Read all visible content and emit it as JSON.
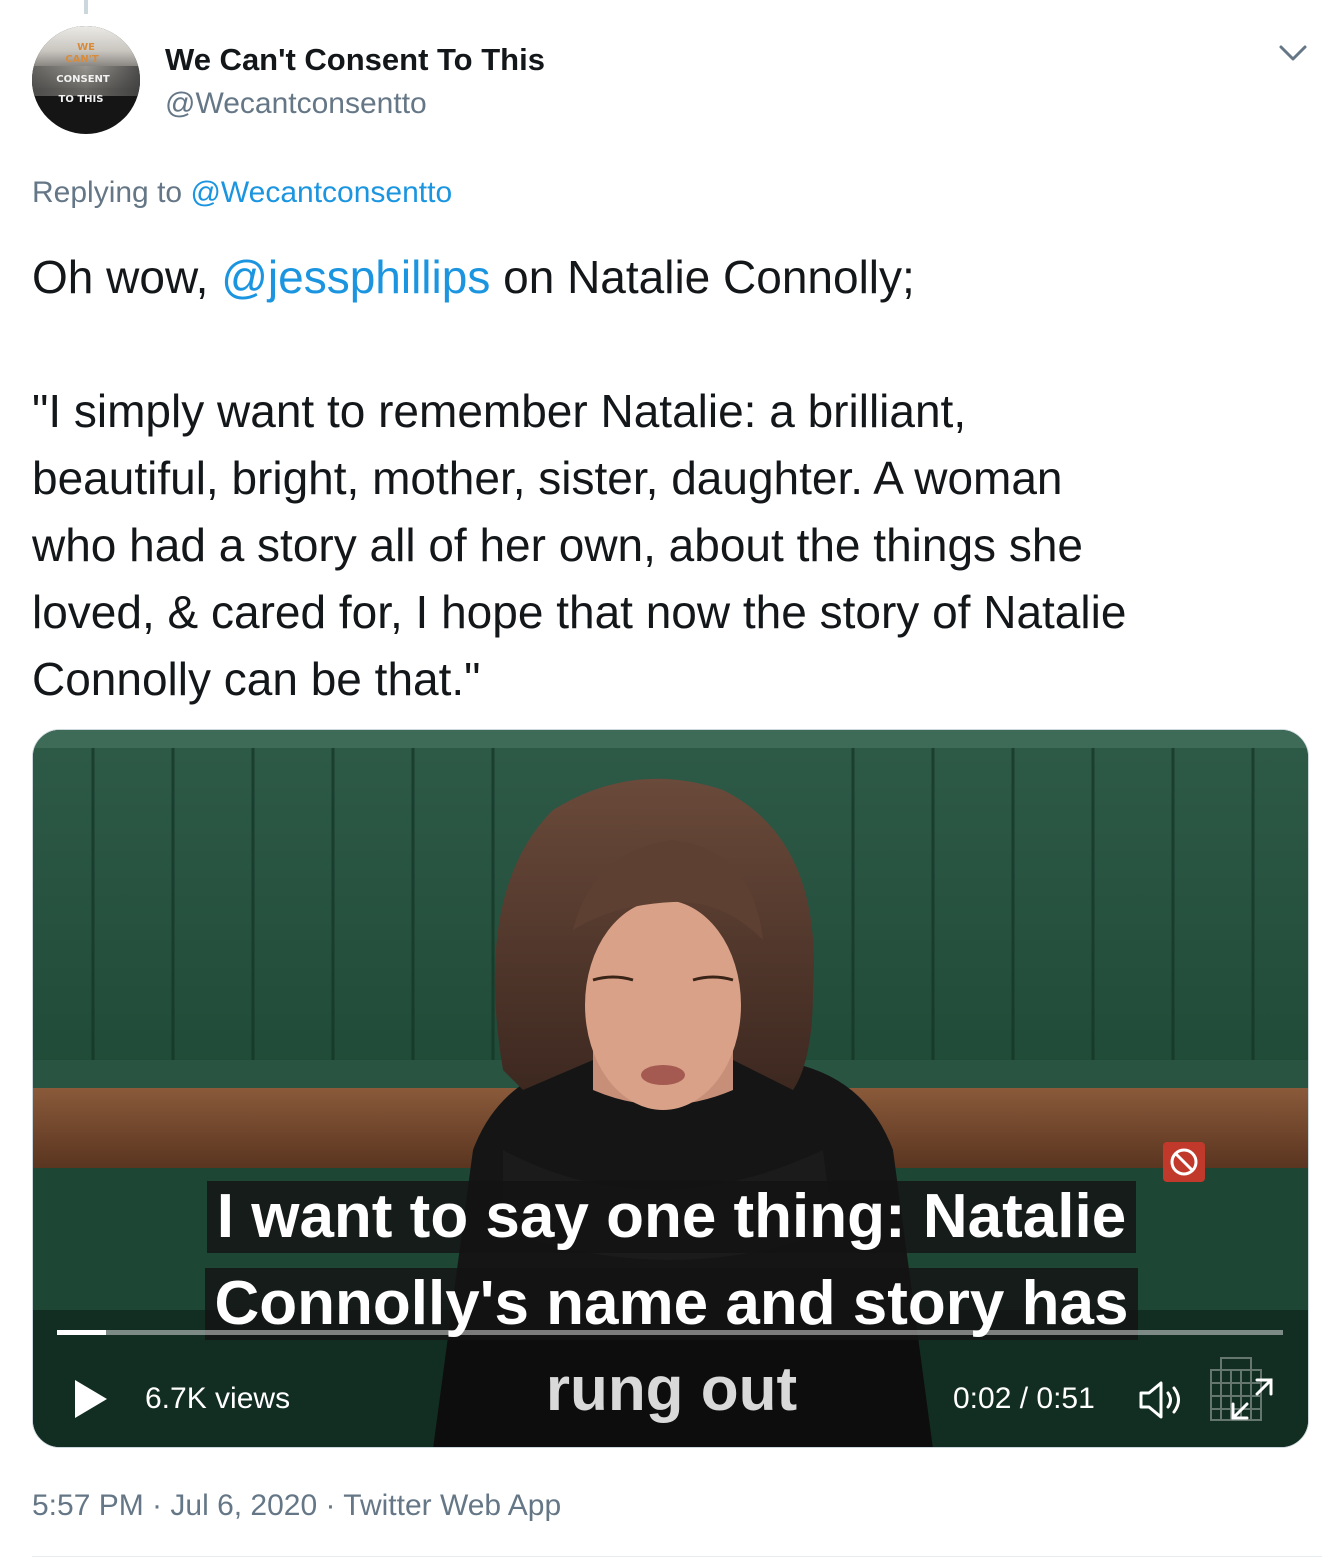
{
  "author": {
    "display_name": "We Can't Consent To This",
    "handle": "@Wecantconsentto",
    "avatar_text": [
      "WE",
      "CAN'T",
      "CONSENT",
      "TO THIS"
    ]
  },
  "reply": {
    "prefix": "Replying to",
    "to_handle": "@Wecantconsentto"
  },
  "tweet": {
    "part1_before": "Oh wow, ",
    "mention": "@jessphillips",
    "part1_after": " on Natalie Connolly;",
    "quote_lines": [
      "\"I simply want to remember Natalie: a brilliant,",
      "beautiful, bright, mother, sister, daughter. A woman",
      "who had a story all of her own, about the things she",
      "loved, & cared for, I hope that now the story of Natalie",
      "Connolly can be that.\""
    ]
  },
  "video": {
    "caption_lines": [
      "I want to say one thing: Natalie",
      "Connolly's name and story has",
      "rung out"
    ],
    "views": "6.7K views",
    "time": "0:02 / 0:51",
    "progress_fraction": 0.04
  },
  "meta": {
    "timestamp": "5:57 PM · Jul 6, 2020 · Twitter Web App"
  },
  "colors": {
    "link": "#1b95e0",
    "secondary_text": "#657786",
    "primary_text": "#14171a"
  },
  "icons": [
    "caret-down-icon",
    "play-icon",
    "volume-icon",
    "fullscreen-icon"
  ]
}
